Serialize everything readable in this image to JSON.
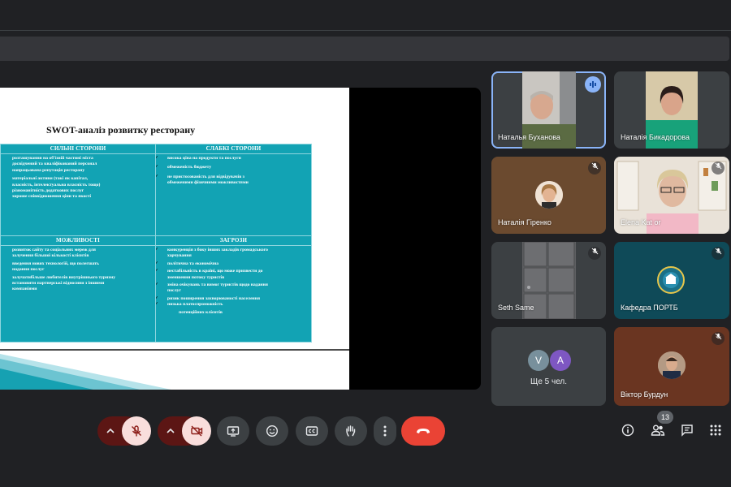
{
  "slide": {
    "title": "SWOT-аналіз розвитку ресторану",
    "strengths": {
      "heading": "СИЛЬНІ СТОРОНИ",
      "items": [
        "розташування на об'їзній частині міста",
        "досвідчений та кваліфікований персонал",
        "напрацьована репутація ресторану",
        "матеріальні активи (такі як капітал,",
        "власність, інтелектуальна власність тощо)",
        "різноманітність додаткових послуг",
        "хороше співвідношення ціни та якості"
      ]
    },
    "weaknesses": {
      "heading": "СЛАБКІ СТОРОНИ",
      "items": [
        "висока ціна на продукти та послуги",
        "обмеженість бюджету",
        "не пристосованість для відвідувачів з",
        "обмеженими фізичними можливостями"
      ]
    },
    "opportunities": {
      "heading": "МОЖЛИВОСТІ",
      "items": [
        "розвиток сайту та соціальних мереж для",
        "залучення більшої кількості клієнтів",
        "введення нових технологій, що полегшать",
        "надання послуг",
        "залучатибільше любителів внутрішнього туризму",
        "встановити партнерські відносини з іншими",
        "компаніями"
      ]
    },
    "threats": {
      "heading": "ЗАГРОЗИ",
      "items": [
        "конкуренція з боку інших закладів громадського",
        "харчування",
        "політична та економічна",
        "нестабільність в країні, що може призвести до",
        "зменшення потоку туристів",
        "зміна очікувань та вимог туристів щодо надання",
        "послуг",
        "ризик поширення захворюваності населення",
        "низька платоспроможність",
        "потенційних клієнтів"
      ]
    }
  },
  "participants": [
    {
      "name": "Наталья Буханова",
      "speaking": true,
      "muted": false
    },
    {
      "name": "Наталія Бикадорова",
      "speaking": false,
      "muted": false
    },
    {
      "name": "Наталія Гіренко",
      "speaking": false,
      "muted": true
    },
    {
      "name": "Elena Kat or",
      "speaking": false,
      "muted": true
    },
    {
      "name": "Seth Same",
      "speaking": false,
      "muted": true
    },
    {
      "name": "Кафедра ПОРТБ",
      "speaking": false,
      "muted": true
    },
    {
      "name": "Віктор Бурдун",
      "speaking": false,
      "muted": true
    }
  ],
  "overflow_tile": {
    "avatars": [
      "V",
      "A"
    ],
    "label": "Ще 5 чел."
  },
  "controls": {
    "people_count": "13"
  },
  "colors": {
    "slide_cell": "#12a3b4",
    "end_call": "#ea4335",
    "mic_off_bg": "#f9dedc",
    "speaking_ring": "#8ab4f8"
  },
  "icons": [
    "chevron-up-icon",
    "mic-off-icon",
    "camera-off-icon",
    "present-icon",
    "emoji-icon",
    "captions-icon",
    "hand-icon",
    "more-icon",
    "end-call-icon",
    "info-icon",
    "people-icon",
    "chat-icon",
    "apps-icon"
  ]
}
